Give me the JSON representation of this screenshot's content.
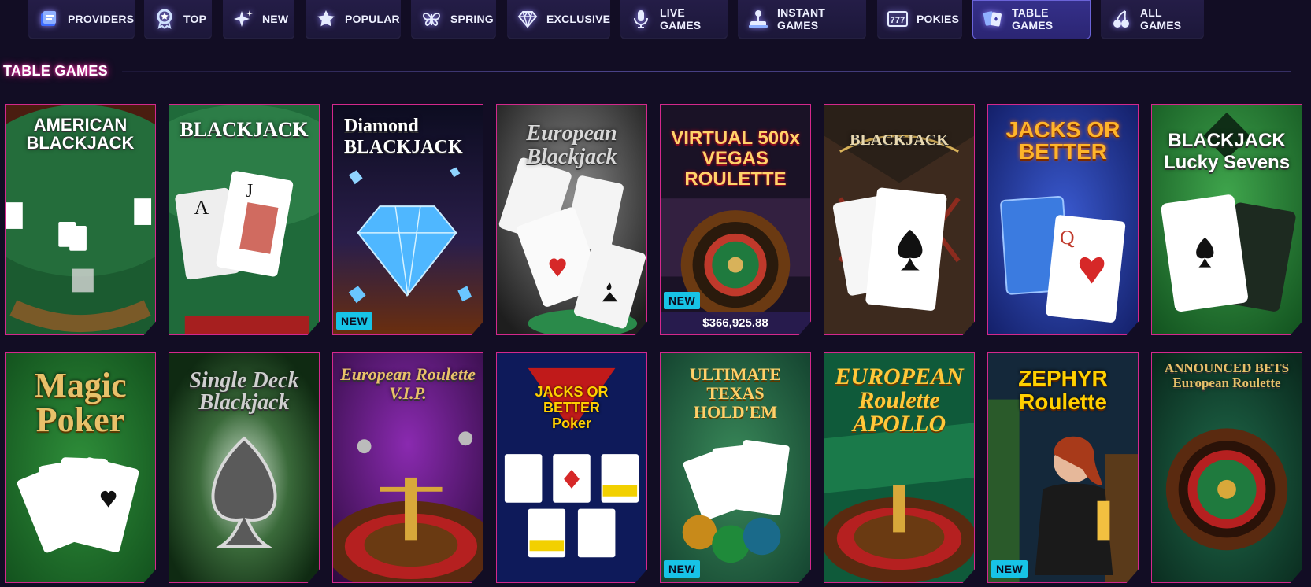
{
  "nav": [
    {
      "label": "PROVIDERS",
      "icon": "providers-icon",
      "active": false
    },
    {
      "label": "TOP",
      "icon": "medal-icon",
      "active": false
    },
    {
      "label": "NEW",
      "icon": "sparkle-icon",
      "active": false
    },
    {
      "label": "POPULAR",
      "icon": "star-icon",
      "active": false
    },
    {
      "label": "SPRING",
      "icon": "butterfly-icon",
      "active": false
    },
    {
      "label": "EXCLUSIVE",
      "icon": "diamond-icon",
      "active": false
    },
    {
      "label": "LIVE GAMES",
      "icon": "microphone-icon",
      "active": false
    },
    {
      "label": "INSTANT GAMES",
      "icon": "joystick-icon",
      "active": false
    },
    {
      "label": "POKIES",
      "icon": "slot-777-icon",
      "active": false
    },
    {
      "label": "TABLE GAMES",
      "icon": "cards-icon",
      "active": true
    },
    {
      "label": "ALL GAMES",
      "icon": "cherries-icon",
      "active": false
    }
  ],
  "section": {
    "title": "TABLE GAMES"
  },
  "games": [
    {
      "title": "AMERICAN BLACKJACK",
      "new": false
    },
    {
      "title": "BLACKJACK",
      "new": false
    },
    {
      "title": "Diamond BLACKJACK",
      "new": true
    },
    {
      "title": "European Blackjack",
      "new": false
    },
    {
      "title": "VIRTUAL 500x VEGAS ROULETTE",
      "new": true,
      "jackpot": "$366,925.88"
    },
    {
      "title": "BLACKJACK",
      "new": false
    },
    {
      "title": "JACKS OR BETTER",
      "new": false
    },
    {
      "title": "BLACKJACK Lucky Sevens",
      "new": false
    },
    {
      "title": "Magic Poker",
      "new": false
    },
    {
      "title": "Single Deck Blackjack",
      "new": false
    },
    {
      "title": "European Roulette V.I.P.",
      "new": false
    },
    {
      "title": "JACKS OR BETTER Poker",
      "new": false
    },
    {
      "title": "ULTIMATE TEXAS HOLD'EM",
      "new": true
    },
    {
      "title": "EUROPEAN Roulette APOLLO",
      "new": false
    },
    {
      "title": "ZEPHYR Roulette",
      "new": true
    },
    {
      "title": "ANNOUNCED BETS European Roulette",
      "new": false
    }
  ],
  "badges": {
    "new_label": "NEW"
  },
  "colors": {
    "background": "#120d24",
    "tile_border": "#d4288c",
    "new_badge": "#17c3e6",
    "active_tab": "#35308a"
  }
}
